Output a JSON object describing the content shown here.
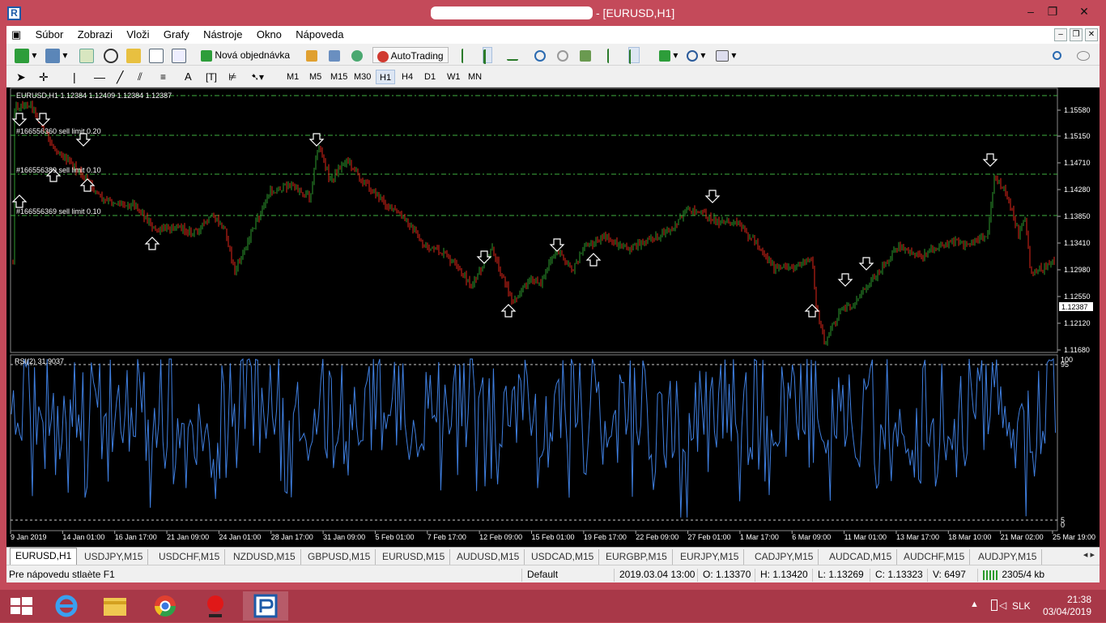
{
  "window": {
    "title": "- [EURUSD,H1]",
    "controls": [
      "–",
      "❐",
      "✕"
    ],
    "mdi_controls": [
      "–",
      "❐",
      "✕"
    ]
  },
  "menu": [
    "Súbor",
    "Zobrazi",
    "Vloži",
    "Grafy",
    "Nástroje",
    "Okno",
    "Nápoveda"
  ],
  "toolbar": {
    "new_order_label": "Nová objednávka",
    "autotrading_label": "AutoTrading"
  },
  "timeframes": [
    "M1",
    "M5",
    "M15",
    "M30",
    "H1",
    "H4",
    "D1",
    "W1",
    "MN"
  ],
  "selected_timeframe": "H1",
  "chart": {
    "header": "EURUSD,H1  1.12384 1.12409 1.12384 1.12387",
    "current_price": "1.12387",
    "price_ticks": [
      "1.15580",
      "1.15150",
      "1.14710",
      "1.14280",
      "1.13850",
      "1.13410",
      "1.12980",
      "1.12550",
      "1.12120",
      "1.11680"
    ],
    "order_labels": [
      "#166556360 sell limit 0.20",
      "#166556389 sell limit 0.10",
      "#166556369 sell limit 0.10"
    ],
    "rsi_label": "RSI(2) 31.9037",
    "rsi_levels": [
      "100",
      "95",
      "5",
      "0"
    ],
    "time_ticks": [
      "9 Jan 2019",
      "14 Jan 01:00",
      "16 Jan 17:00",
      "21 Jan 09:00",
      "24 Jan 01:00",
      "28 Jan 17:00",
      "31 Jan 09:00",
      "5 Feb 01:00",
      "7 Feb 17:00",
      "12 Feb 09:00",
      "15 Feb 01:00",
      "19 Feb 17:00",
      "22 Feb 09:00",
      "27 Feb 01:00",
      "1 Mar 17:00",
      "6 Mar 09:00",
      "11 Mar 01:00",
      "13 Mar 17:00",
      "18 Mar 10:00",
      "21 Mar 02:00",
      "25 Mar 19:00"
    ],
    "colors": {
      "bull": "#2e9a2e",
      "bear": "#e0261a",
      "grid": "#40b040",
      "rsi": "#3f7fe0"
    }
  },
  "chart_tabs": [
    "EURUSD,H1",
    "USDJPY,M15",
    "USDCHF,M15",
    "NZDUSD,M15",
    "GBPUSD,M15",
    "EURUSD,M15",
    "AUDUSD,M15",
    "USDCAD,M15",
    "EURGBP,M15",
    "EURJPY,M15",
    "CADJPY,M15",
    "AUDCAD,M15",
    "AUDCHF,M15",
    "AUDJPY,M15"
  ],
  "status": {
    "help": "Pre nápovedu stlaète F1",
    "profile": "Default",
    "datetime": "2019.03.04 13:00",
    "open": "O: 1.13370",
    "high": "H: 1.13420",
    "low": "L: 1.13269",
    "close": "C: 1.13323",
    "volume": "V: 6497",
    "traffic": "2305/4 kb"
  },
  "taskbar": {
    "lang": "SLK",
    "time": "21:38",
    "date": "03/04/2019"
  }
}
